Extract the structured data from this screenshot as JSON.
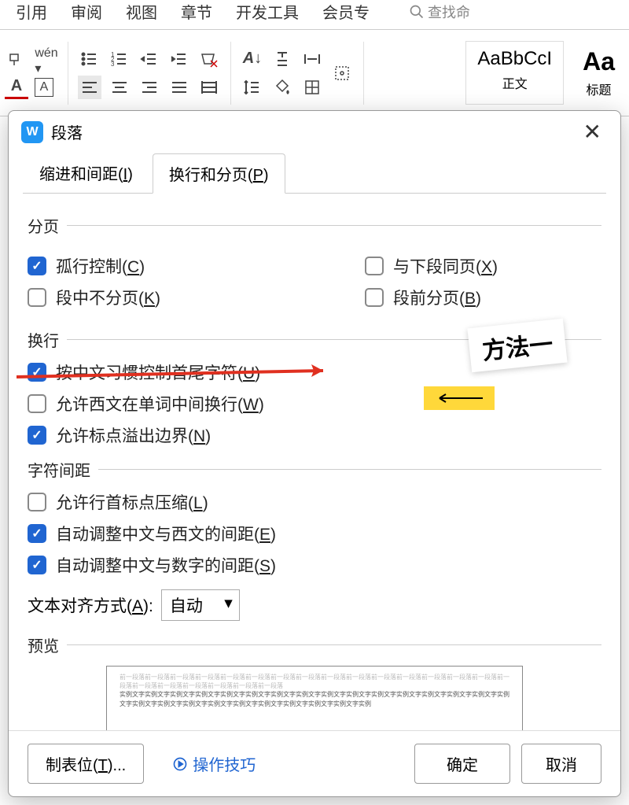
{
  "ribbon": {
    "tabs": [
      "引用",
      "审阅",
      "视图",
      "章节",
      "开发工具",
      "会员专"
    ],
    "search": "查找命",
    "styles": [
      {
        "preview": "AaBbCcI",
        "label": "正文"
      },
      {
        "preview": "Aa",
        "label": "标题"
      }
    ]
  },
  "dialog": {
    "title": "段落",
    "tabs": {
      "indent": "缩进和间距(I)",
      "line": "换行和分页(P)"
    },
    "sections": {
      "page": "分页",
      "wrap": "换行",
      "spacing": "字符间距",
      "preview": "预览"
    },
    "checks": {
      "orphan": "孤行控制(C)",
      "keep_next": "与下段同页(X)",
      "keep_lines": "段中不分页(K)",
      "page_before": "段前分页(B)",
      "cjk_first": "按中文习惯控制首尾字符(U)",
      "latin_wrap": "允许西文在单词中间换行(W)",
      "punct_overflow": "允许标点溢出边界(N)",
      "punct_compress": "允许行首标点压缩(L)",
      "cjk_latin_space": "自动调整中文与西文的间距(E)",
      "cjk_num_space": "自动调整中文与数字的间距(S)"
    },
    "align_label": "文本对齐方式(A):",
    "align_value": "自动",
    "preview_light": "前一段落前一段落前一段落前一段落前一段落前一段落前一段落前一段落前一段落前一段落前一段落前一段落前一段落前一段落前一段落前一段落前一段落前一段落前一段落前一段落前一段落前一段落",
    "preview_dark": "实例文字实例文字实例文字实例文字实例文字实例文字实例文字实例文字实例文字实例文字实例文字实例文字实例文字实例文字实例文字实例文字实例文字实例文字实例文字实例文字实例文字实例文字实例文字实例文字实例文字实例",
    "footer": {
      "tabs": "制表位(T)...",
      "tips": "操作技巧",
      "ok": "确定",
      "cancel": "取消"
    }
  },
  "annotation": "方法一"
}
